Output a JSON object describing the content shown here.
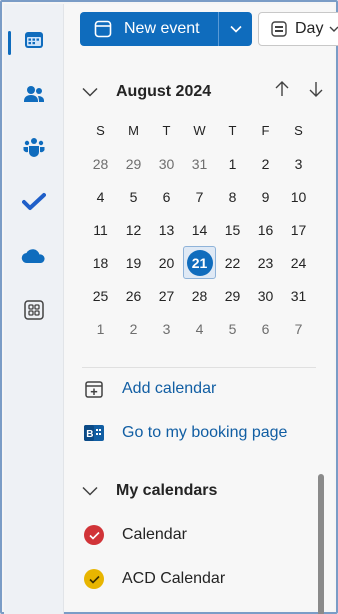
{
  "toolbar": {
    "new_event_label": "New event",
    "view_label": "Day"
  },
  "rail": {
    "items": [
      {
        "name": "calendar-icon",
        "active": true
      },
      {
        "name": "people-icon"
      },
      {
        "name": "teams-icon"
      },
      {
        "name": "todo-icon"
      },
      {
        "name": "onedrive-icon"
      },
      {
        "name": "apps-icon"
      }
    ]
  },
  "calendar": {
    "month_title": "August 2024",
    "weekdays": [
      "S",
      "M",
      "T",
      "W",
      "T",
      "F",
      "S"
    ],
    "weeks": [
      [
        {
          "d": "28",
          "m": true
        },
        {
          "d": "29",
          "m": true
        },
        {
          "d": "30",
          "m": true
        },
        {
          "d": "31",
          "m": true
        },
        {
          "d": "1"
        },
        {
          "d": "2"
        },
        {
          "d": "3"
        }
      ],
      [
        {
          "d": "4"
        },
        {
          "d": "5"
        },
        {
          "d": "6"
        },
        {
          "d": "7"
        },
        {
          "d": "8"
        },
        {
          "d": "9"
        },
        {
          "d": "10"
        }
      ],
      [
        {
          "d": "11"
        },
        {
          "d": "12"
        },
        {
          "d": "13"
        },
        {
          "d": "14"
        },
        {
          "d": "15"
        },
        {
          "d": "16"
        },
        {
          "d": "17"
        }
      ],
      [
        {
          "d": "18"
        },
        {
          "d": "19"
        },
        {
          "d": "20"
        },
        {
          "d": "21",
          "today": true
        },
        {
          "d": "22"
        },
        {
          "d": "23"
        },
        {
          "d": "24"
        }
      ],
      [
        {
          "d": "25"
        },
        {
          "d": "26"
        },
        {
          "d": "27"
        },
        {
          "d": "28"
        },
        {
          "d": "29"
        },
        {
          "d": "30"
        },
        {
          "d": "31"
        }
      ],
      [
        {
          "d": "1",
          "m": true
        },
        {
          "d": "2",
          "m": true
        },
        {
          "d": "3",
          "m": true
        },
        {
          "d": "4",
          "m": true
        },
        {
          "d": "5",
          "m": true
        },
        {
          "d": "6",
          "m": true
        },
        {
          "d": "7",
          "m": true
        }
      ]
    ]
  },
  "links": {
    "add_calendar": "Add calendar",
    "booking_page": "Go to my booking page"
  },
  "my_calendars": {
    "header": "My calendars",
    "items": [
      {
        "label": "Calendar",
        "color": "#d13438"
      },
      {
        "label": "ACD Calendar",
        "color": "#e8b500"
      }
    ]
  },
  "colors": {
    "accent": "#0f6cbd",
    "link": "#115ea3"
  }
}
